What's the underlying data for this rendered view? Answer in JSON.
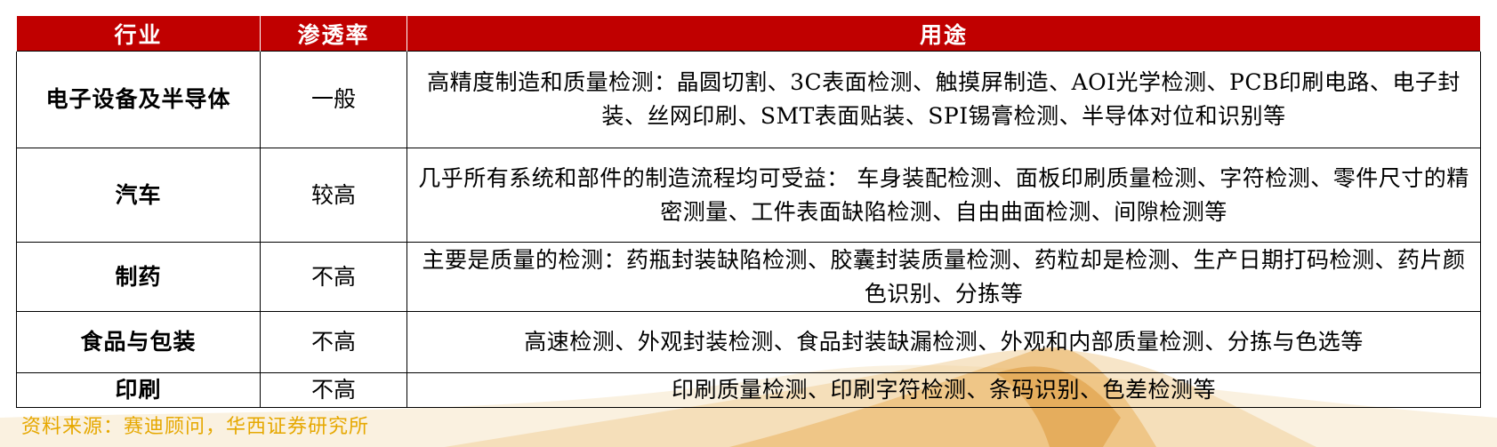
{
  "table": {
    "headers": [
      "行业",
      "渗透率",
      "用途"
    ],
    "rows": [
      {
        "industry": "电子设备及半导体",
        "penetration": "一般",
        "usage": "高精度制造和质量检测：晶圆切割、3C表面检测、触摸屏制造、AOI光学检测、PCB印刷电路、电子封装、丝网印刷、SMT表面贴装、SPI锡膏检测、半导体对位和识别等"
      },
      {
        "industry": "汽车",
        "penetration": "较高",
        "usage": "几乎所有系统和部件的制造流程均可受益： 车身装配检测、面板印刷质量检测、字符检测、零件尺寸的精密测量、工件表面缺陷检测、自由曲面检测、间隙检测等"
      },
      {
        "industry": "制药",
        "penetration": "不高",
        "usage": "主要是质量的检测：药瓶封装缺陷检测、胶囊封装质量检测、药粒却是检测、生产日期打码检测、药片颜色识别、分拣等"
      },
      {
        "industry": "食品与包装",
        "penetration": "不高",
        "usage": "高速检测、外观封装检测、食品封装缺漏检测、外观和内部质量检测、分拣与色选等"
      },
      {
        "industry": "印刷",
        "penetration": "不高",
        "usage": "印刷质量检测、印刷字符检测、条码识别、色差检测等"
      }
    ]
  },
  "source": "资料来源：赛迪顾问，华西证券研究所",
  "colors": {
    "header_bg": "#c00000",
    "header_text": "#ffffff",
    "source_text": "#e6a800"
  }
}
